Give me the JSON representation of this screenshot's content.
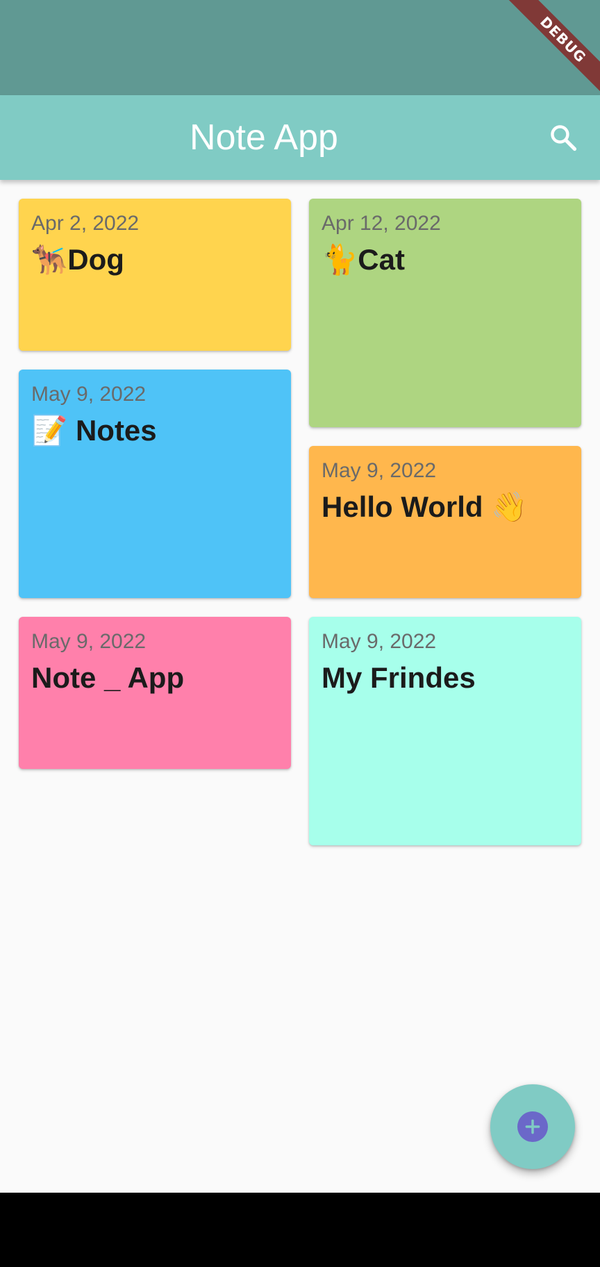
{
  "status_bar": {
    "debug_label": "DEBUG"
  },
  "app_bar": {
    "title": "Note App",
    "search_icon": "search-icon"
  },
  "notes": [
    {
      "date": "Apr 2, 2022",
      "title": "🐕‍🦺Dog",
      "color": "#ffd44e"
    },
    {
      "date": "Apr 12, 2022",
      "title": "🐈Cat",
      "color": "#aed581"
    },
    {
      "date": "May 9, 2022",
      "title": "📝 Notes",
      "color": "#4fc3f7"
    },
    {
      "date": "May 9, 2022",
      "title": "Hello World 👋",
      "color": "#ffb74d"
    },
    {
      "date": "May 9, 2022",
      "title": "Note _ App",
      "color": "#ff80ab"
    },
    {
      "date": "May 9, 2022",
      "title": "My Frindes",
      "color": "#a7ffeb"
    }
  ],
  "fab": {
    "icon": "add-circle-icon"
  },
  "colors": {
    "status_bar": "#609993",
    "app_bar": "#80cbc4",
    "background": "#fafafa",
    "fab_icon": "#6b68c9"
  }
}
